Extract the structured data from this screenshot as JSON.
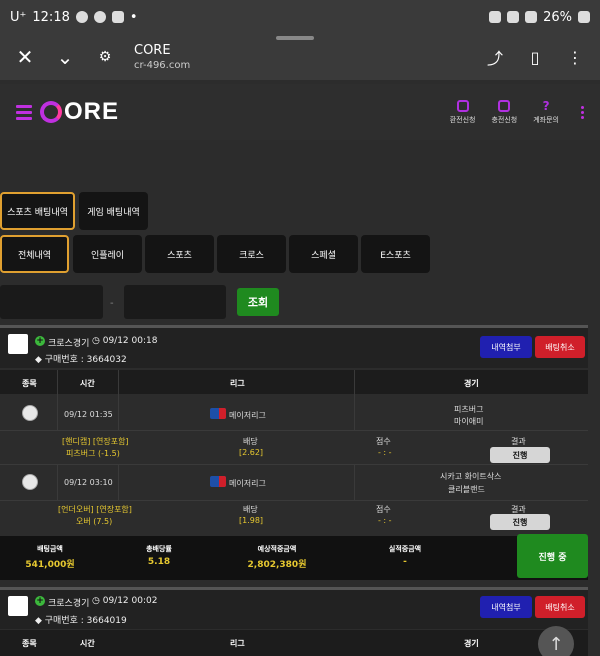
{
  "statusbar": {
    "carrier": "U⁺",
    "time": "12:18",
    "dot": "•",
    "battery": "26%"
  },
  "browser": {
    "title": "CORE",
    "url": "cr-496.com"
  },
  "site": {
    "logo_text": "ORE",
    "nav": [
      {
        "label": "환전신청",
        "icon": "deposit-icon"
      },
      {
        "label": "충전신청",
        "icon": "charge-icon"
      },
      {
        "label": "계좌문의",
        "icon": "question-icon",
        "glyph": "?"
      }
    ]
  },
  "tabs_top": [
    "스포츠 배팅내역",
    "게임 배팅내역"
  ],
  "tabs_filter": [
    "전체내역",
    "인플레이",
    "스포츠",
    "크로스",
    "스페셜",
    "E스포츠"
  ],
  "filter": {
    "sep": "-",
    "search_label": "조회"
  },
  "bets": [
    {
      "title": "크로스경기",
      "datetime": "◷ 09/12 00:18",
      "purchase": "◆ 구매번호 : 3664032",
      "detail_label": "내역첨부",
      "cancel_label": "배팅취소",
      "headers": {
        "type": "종목",
        "time": "시간",
        "league": "리그",
        "match": "경기"
      },
      "games": [
        {
          "time": "09/12 01:35",
          "league": "메이저리그",
          "team1": "피츠버그",
          "team2": "마이애미",
          "market": "[핸디캡] [연장포함]",
          "pick": "피츠버그 (-1.5)",
          "odds_label": "배당",
          "odds": "[2.62]",
          "score_label": "점수",
          "score": "- : -",
          "result_label": "결과",
          "status": "진행"
        },
        {
          "time": "09/12 03:10",
          "league": "메이저리그",
          "team1": "시카고 화이트삭스",
          "team2": "클리블랜드",
          "market": "[언더오버] [연장포함]",
          "pick": "오버 (7.5)",
          "odds_label": "배당",
          "odds": "[1.98]",
          "score_label": "점수",
          "score": "- : -",
          "result_label": "결과",
          "status": "진행"
        }
      ],
      "summary": {
        "bet_amount_label": "배팅금액",
        "bet_amount": "541,000원",
        "total_odds_label": "총배당률",
        "total_odds": "5.18",
        "expected_label": "예상적중금액",
        "expected": "2,802,380원",
        "actual_label": "실적중금액",
        "actual": "-",
        "progress": "진행 중"
      }
    },
    {
      "title": "크로스경기",
      "datetime": "◷ 09/12 00:02",
      "purchase": "◆ 구매번호 : 3664019",
      "detail_label": "내역첨부",
      "cancel_label": "배팅취소",
      "headers": {
        "type": "종목",
        "time": "시간",
        "league": "리그",
        "match": "경기"
      }
    }
  ],
  "scroll_up": "↑"
}
